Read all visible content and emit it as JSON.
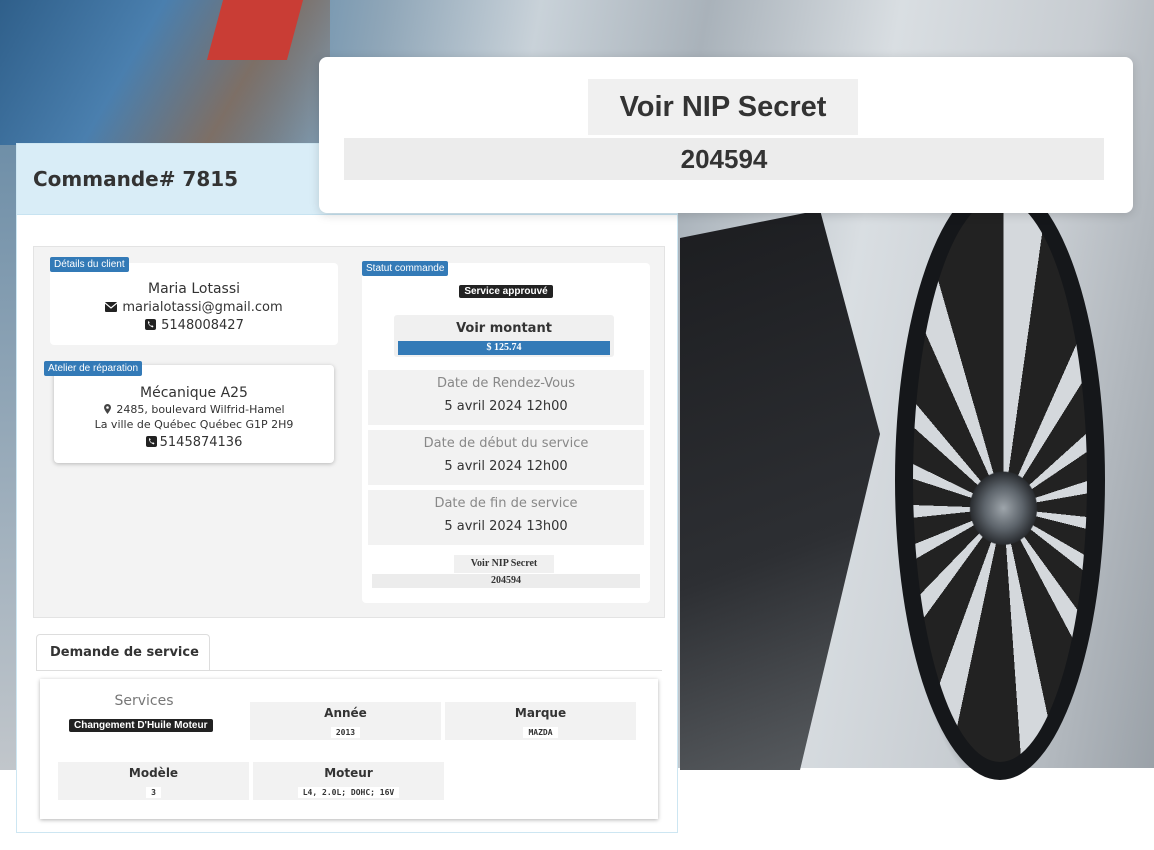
{
  "order": {
    "title": "Commande# 7815"
  },
  "client": {
    "tag": "Détails du client",
    "name": "Maria Lotassi",
    "email": "marialotassi@gmail.com",
    "phone": "5148008427"
  },
  "shop": {
    "tag": "Atelier de réparation",
    "name": "Mécanique A25",
    "address_line1": "2485, boulevard Wilfrid-Hamel",
    "address_line2": "La ville de Québec Québec G1P 2H9",
    "phone": "5145874136"
  },
  "status": {
    "tag": "Statut commande",
    "badge": "Service approuvé",
    "amount_label": "Voir montant",
    "amount_value": "$ 125.74",
    "appointment_label": "Date de Rendez-Vous",
    "appointment_value": "5 avril 2024 12h00",
    "start_label": "Date de début du service",
    "start_value": "5 avril 2024 12h00",
    "end_label": "Date de fin de service",
    "end_value": "5 avril 2024 13h00",
    "nip_label": "Voir NIP Secret",
    "nip_value": "204594"
  },
  "service_request": {
    "tab_label": "Demande de service",
    "services_label": "Services",
    "service_badge": "Changement D'Huile Moteur",
    "year_label": "Année",
    "year_value": "2013",
    "make_label": "Marque",
    "make_value": "MAZDA",
    "model_label": "Modèle",
    "model_value": "3",
    "engine_label": "Moteur",
    "engine_value": "L4, 2.0L; DOHC; 16V"
  },
  "popup": {
    "label": "Voir NIP Secret",
    "value": "204594"
  },
  "icons": {
    "email": "envelope-icon",
    "phone": "phone-icon",
    "location": "map-marker-icon"
  },
  "colors": {
    "accent": "#337ab7",
    "header_bg": "#d9edf7",
    "badge_dark": "#222222"
  }
}
